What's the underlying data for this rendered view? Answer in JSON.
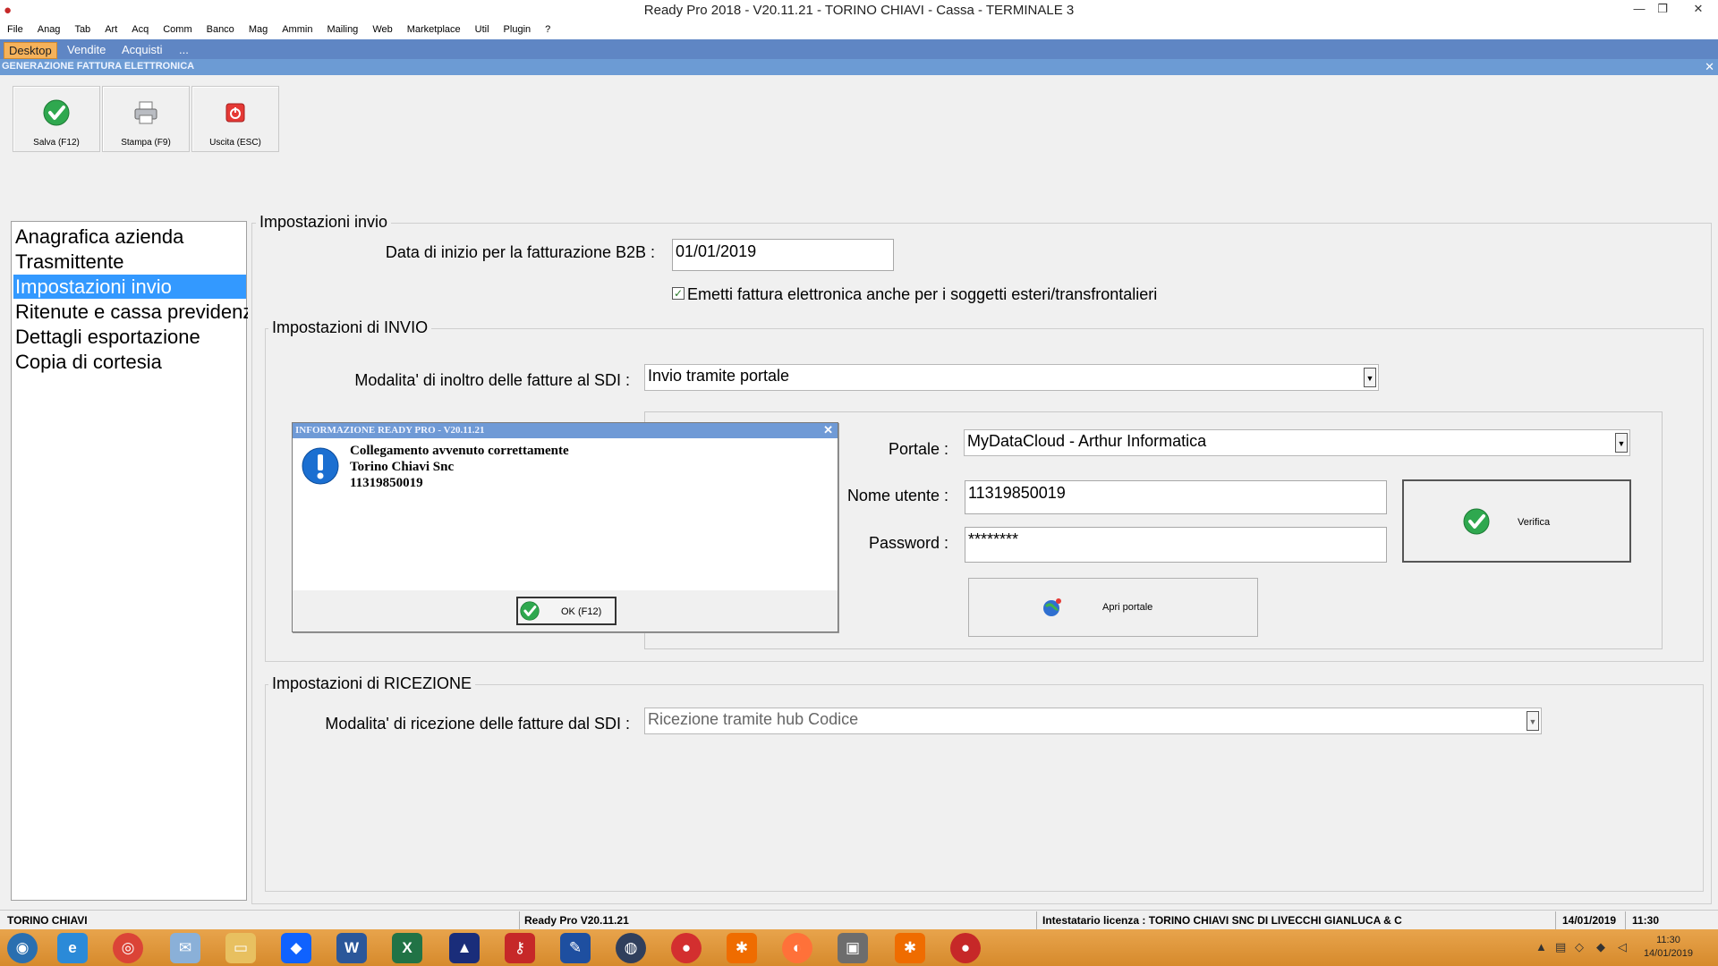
{
  "window": {
    "title": "Ready Pro 2018 - V20.11.21 - TORINO CHIAVI - Cassa - TERMINALE 3",
    "minimize": "—",
    "restore": "❐",
    "close": "✕"
  },
  "menu": [
    "File",
    "Anag",
    "Tab",
    "Art",
    "Acq",
    "Comm",
    "Banco",
    "Mag",
    "Ammin",
    "Mailing",
    "Web",
    "Marketplace",
    "Util",
    "Plugin",
    "?"
  ],
  "tabs": [
    "Desktop",
    "Vendite",
    "Acquisti",
    "..."
  ],
  "caption": "GENERAZIONE FATTURA ELETTRONICA",
  "toolbar": {
    "save": "Salva (F12)",
    "print": "Stampa (F9)",
    "exit": "Uscita (ESC)"
  },
  "nav": [
    "Anagrafica azienda",
    "Trasmittente",
    "Impostazioni invio",
    "Ritenute e cassa previdenziale",
    "Dettagli esportazione",
    "Copia di cortesia"
  ],
  "settings": {
    "legend": "Impostazioni invio",
    "b2b_label": "Data di inizio per la fatturazione B2B :",
    "b2b_value": "01/01/2019",
    "foreign_label": "Emetti fattura elettronica anche per i soggetti esteri/transfrontalieri",
    "foreign_checked": true,
    "send": {
      "legend": "Impostazioni di INVIO",
      "mode_label": "Modalita' di inoltro delle fatture al SDI :",
      "mode_value": "Invio tramite portale",
      "portal_label": "Portale :",
      "portal_value": "MyDataCloud - Arthur Informatica",
      "user_label": "Nome utente :",
      "user_value": "11319850019",
      "password_label": "Password :",
      "password_value": "********",
      "verify": "Verifica",
      "open_portal": "Apri portale"
    },
    "receive": {
      "legend": "Impostazioni di RICEZIONE",
      "mode_label": "Modalita' di ricezione delle fatture dal SDI :",
      "mode_value": "Ricezione tramite hub Codice"
    }
  },
  "dialog": {
    "title": "INFORMAZIONE READY PRO - V20.11.21",
    "line1": "Collegamento avvenuto correttamente",
    "line2": "Torino Chiavi Snc",
    "line3": "11319850019",
    "ok": "OK (F12)"
  },
  "status": {
    "company": "TORINO CHIAVI",
    "version": "Ready Pro V20.11.21",
    "license": "Intestatario licenza : TORINO CHIAVI SNC DI LIVECCHI GIANLUCA & C",
    "date": "14/01/2019",
    "time": "11:30"
  },
  "taskbar": {
    "time": "11:30",
    "date": "14/01/2019"
  },
  "colors": {
    "tab_bar": "#5f86c4",
    "active_tab": "#f6b25a",
    "caption": "#6c9bd4",
    "selection": "#3399ff",
    "taskbar": "#d68a2c"
  }
}
